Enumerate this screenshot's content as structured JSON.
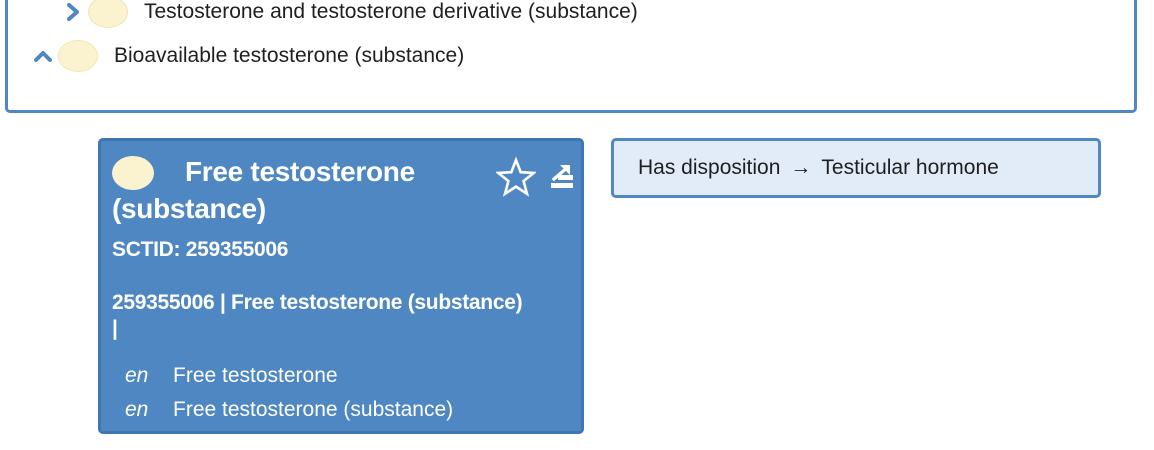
{
  "parents": [
    {
      "label": "Testosterone and testosterone derivative (substance)",
      "chevron": "chevron-right-icon",
      "state": "collapsed"
    },
    {
      "label": "Bioavailable testosterone (substance)",
      "chevron": "chevron-up-icon",
      "state": "expanded"
    }
  ],
  "concept": {
    "title": "Free testosterone (substance)",
    "sctid_line": "SCTID: 259355006",
    "fsn_line": "259355006 | Free testosterone (substance) |",
    "descriptions": [
      {
        "lang": "en",
        "term": "Free testosterone"
      },
      {
        "lang": "en",
        "term": "Free testosterone (substance)"
      }
    ],
    "favorite_icon": "star-icon",
    "export_icon": "export-icon"
  },
  "relationship": {
    "type": "Has disposition",
    "arrow": "→",
    "target": "Testicular hormone"
  },
  "colors": {
    "card_blue": "#4f87c2",
    "definition_oval": "#fbf2d0",
    "relationship_bg": "#e1ecf8"
  }
}
